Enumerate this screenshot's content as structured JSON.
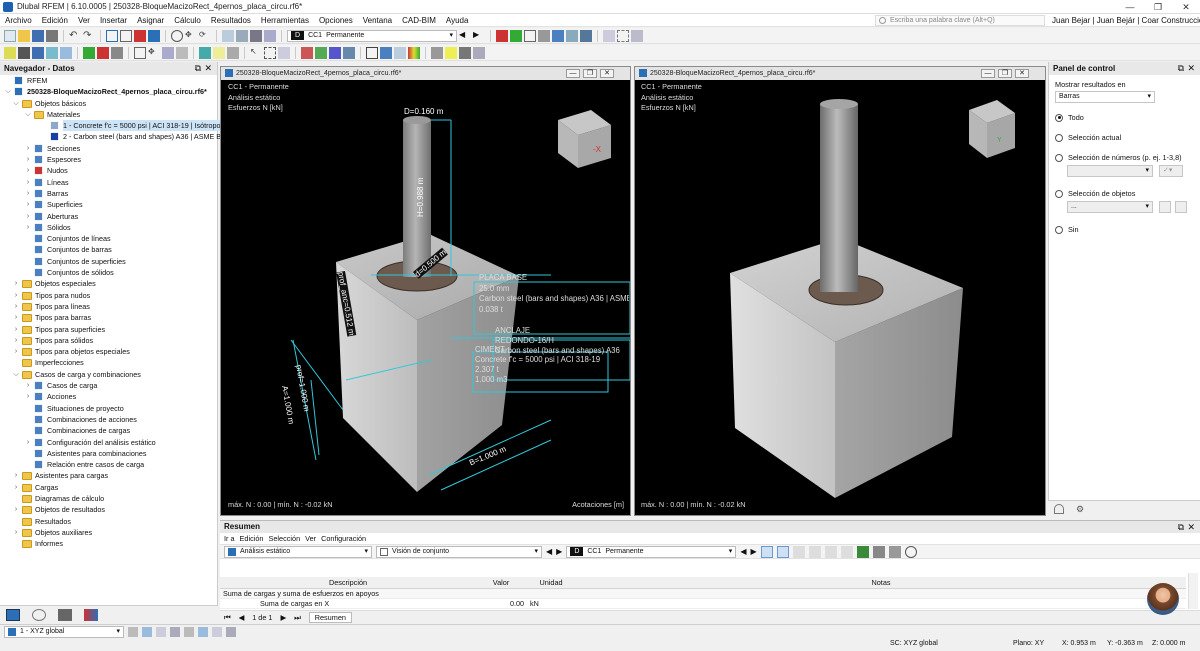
{
  "window": {
    "title": "Dlubal RFEM | 6.10.0005 | 250328-BloqueMacizoRect_4pernos_placa_circu.rf6*"
  },
  "menu": [
    "Archivo",
    "Edición",
    "Ver",
    "Insertar",
    "Asignar",
    "Cálculo",
    "Resultados",
    "Herramientas",
    "Opciones",
    "Ventana",
    "CAD-BIM",
    "Ayuda"
  ],
  "search": {
    "placeholder": "Escriba una palabra clave (Alt+Q)"
  },
  "user": {
    "name": "Juan Bejar | Juan Bejár | Coar Construcciones"
  },
  "toolbar": {
    "design_situation_badge": "D",
    "load_case_code": "CC1",
    "load_case_name": "Permanente"
  },
  "navigator": {
    "title": "Navegador - Datos",
    "items": [
      {
        "label": "RFEM",
        "level": 0,
        "exp": "",
        "icon": "rfem-icon"
      },
      {
        "label": "250328-BloqueMacizoRect_4pernos_placa_circu.rf6*",
        "level": 0,
        "exp": "v",
        "icon": "model-file-icon",
        "bold": true
      },
      {
        "label": "Objetos básicos",
        "level": 1,
        "exp": "v",
        "icon": "folder-icon"
      },
      {
        "label": "Materiales",
        "level": 2,
        "exp": "v",
        "icon": "folder-icon"
      },
      {
        "label": "1 - Concrete f'c = 5000 psi | ACI 318-19 | Isótropo",
        "level": 3,
        "exp": "",
        "icon": "material-concrete-icon",
        "selected": true
      },
      {
        "label": "2 - Carbon steel (bars and shapes) A36 | ASME B",
        "level": 3,
        "exp": "",
        "icon": "material-steel-icon"
      },
      {
        "label": "Secciones",
        "level": 2,
        "exp": ">",
        "icon": "sections-icon"
      },
      {
        "label": "Espesores",
        "level": 2,
        "exp": ">",
        "icon": "thickness-icon"
      },
      {
        "label": "Nudos",
        "level": 2,
        "exp": ">",
        "icon": "node-icon"
      },
      {
        "label": "Líneas",
        "level": 2,
        "exp": ">",
        "icon": "line-icon"
      },
      {
        "label": "Barras",
        "level": 2,
        "exp": ">",
        "icon": "member-icon"
      },
      {
        "label": "Superficies",
        "level": 2,
        "exp": ">",
        "icon": "surface-icon"
      },
      {
        "label": "Aberturas",
        "level": 2,
        "exp": ">",
        "icon": "opening-icon"
      },
      {
        "label": "Sólidos",
        "level": 2,
        "exp": ">",
        "icon": "solid-icon"
      },
      {
        "label": "Conjuntos de líneas",
        "level": 2,
        "exp": "",
        "icon": "line-set-icon"
      },
      {
        "label": "Conjuntos de barras",
        "level": 2,
        "exp": "",
        "icon": "member-set-icon"
      },
      {
        "label": "Conjuntos de superficies",
        "level": 2,
        "exp": "",
        "icon": "surface-set-icon"
      },
      {
        "label": "Conjuntos de sólidos",
        "level": 2,
        "exp": "",
        "icon": "solid-set-icon"
      },
      {
        "label": "Objetos especiales",
        "level": 1,
        "exp": ">",
        "icon": "folder-icon"
      },
      {
        "label": "Tipos para nudos",
        "level": 1,
        "exp": ">",
        "icon": "folder-icon"
      },
      {
        "label": "Tipos para líneas",
        "level": 1,
        "exp": ">",
        "icon": "folder-icon"
      },
      {
        "label": "Tipos para barras",
        "level": 1,
        "exp": ">",
        "icon": "folder-icon"
      },
      {
        "label": "Tipos para superficies",
        "level": 1,
        "exp": ">",
        "icon": "folder-icon"
      },
      {
        "label": "Tipos para sólidos",
        "level": 1,
        "exp": ">",
        "icon": "folder-icon"
      },
      {
        "label": "Tipos para objetos especiales",
        "level": 1,
        "exp": ">",
        "icon": "folder-icon"
      },
      {
        "label": "Imperfecciones",
        "level": 1,
        "exp": "",
        "icon": "folder-icon"
      },
      {
        "label": "Casos de carga y combinaciones",
        "level": 1,
        "exp": "v",
        "icon": "folder-icon"
      },
      {
        "label": "Casos de carga",
        "level": 2,
        "exp": ">",
        "icon": "load-case-icon"
      },
      {
        "label": "Acciones",
        "level": 2,
        "exp": ">",
        "icon": "action-icon"
      },
      {
        "label": "Situaciones de proyecto",
        "level": 2,
        "exp": "",
        "icon": "design-situation-icon"
      },
      {
        "label": "Combinaciones de acciones",
        "level": 2,
        "exp": "",
        "icon": "action-combination-icon"
      },
      {
        "label": "Combinaciones de cargas",
        "level": 2,
        "exp": "",
        "icon": "load-combination-icon"
      },
      {
        "label": "Configuración del análisis estático",
        "level": 2,
        "exp": ">",
        "icon": "static-settings-icon"
      },
      {
        "label": "Asistentes para combinaciones",
        "level": 2,
        "exp": "",
        "icon": "combination-wizard-icon"
      },
      {
        "label": "Relación entre casos de carga",
        "level": 2,
        "exp": "",
        "icon": "relationship-icon"
      },
      {
        "label": "Asistentes para cargas",
        "level": 1,
        "exp": ">",
        "icon": "folder-icon"
      },
      {
        "label": "Cargas",
        "level": 1,
        "exp": ">",
        "icon": "folder-icon"
      },
      {
        "label": "Diagramas de cálculo",
        "level": 1,
        "exp": "",
        "icon": "folder-icon"
      },
      {
        "label": "Objetos de resultados",
        "level": 1,
        "exp": ">",
        "icon": "folder-icon"
      },
      {
        "label": "Resultados",
        "level": 1,
        "exp": "",
        "icon": "folder-icon"
      },
      {
        "label": "Objetos auxiliares",
        "level": 1,
        "exp": ">",
        "icon": "folder-icon"
      },
      {
        "label": "Informes",
        "level": 1,
        "exp": "",
        "icon": "folder-icon"
      }
    ]
  },
  "viewport_left": {
    "tab_title": "250328-BloqueMacizoRect_4pernos_placa_circu.rf6*",
    "info_lines": [
      "CC1 - Permanente",
      "Análisis estático",
      "Esfuerzos N [kN]"
    ],
    "footer_left": "máx. N : 0.00 | mín. N : -0.02 kN",
    "footer_right": "Acotaciones [m]",
    "dims": {
      "diameter": "D=0.160 m",
      "height": "H=0.988 m",
      "depth": "d=0.500 m",
      "prof_anc": "prof_anc=0.512 m",
      "prof": "prof=1.000 m",
      "b_side": "B=1.000 m",
      "a_side": "A=1.000 m"
    },
    "labels": {
      "placa_title": "PLACA BASE",
      "placa_thick": "25.0 mm",
      "placa_mat": "Carbon steel (bars and shapes) A36 | ASME B",
      "placa_weight": "0.038 t",
      "anclaje_title": "ANCLAJE",
      "anclaje_sub": "REDONDO-16/H",
      "anclaje_mat": "Carbon steel (bars and shapes) A36",
      "cim_title": "CIMENT",
      "cim_mat": "Concrete f'c = 5000 psi | ACI 318-19",
      "cim_weight": "2.307 t",
      "cim_vol": "1.000 m3"
    }
  },
  "viewport_right": {
    "tab_title": "250328-BloqueMacizoRect_4pernos_placa_circu.rf6*",
    "info_lines": [
      "CC1 - Permanente",
      "Análisis estático",
      "Esfuerzos N [kN]"
    ],
    "footer_left": "máx. N : 0.00 | mín. N : -0.02 kN"
  },
  "control_panel": {
    "title": "Panel de control",
    "show_results_label": "Mostrar resultados en",
    "show_results_value": "Barras",
    "options": [
      "Todo",
      "Selección actual",
      "Selección de números (p. ej. 1-3,8)",
      "Selección de objetos",
      "Sin"
    ],
    "selected_option": "Todo",
    "sel_objects_placeholder": "..."
  },
  "results": {
    "title": "Resumen",
    "menu": [
      "Ir a",
      "Edición",
      "Selección",
      "Ver",
      "Configuración"
    ],
    "analysis_type": "Análisis estático",
    "view_type": "Visión de conjunto",
    "design_situation_badge": "D",
    "load_case_code": "CC1",
    "load_case_name": "Permanente",
    "columns": [
      "Descripción",
      "Valor",
      "Unidad",
      "Notas"
    ],
    "group_row": "Suma de cargas y suma de esfuerzos en apoyos",
    "rows": [
      {
        "description": "Suma de cargas en X",
        "value": "0.00",
        "unit": "kN",
        "notes": ""
      }
    ],
    "pager": "1 de 1",
    "tab": "Resumen"
  },
  "statusbar": {
    "coord_system_combo": "1 - XYZ global",
    "sc": "SC: XYZ global",
    "plane": "Plano: XY",
    "x": "X: 0.953 m",
    "y": "Y: -0.363 m",
    "z": "Z: 0.000 m"
  },
  "colors": {
    "accent": "#2b6fb7",
    "dimension_cyan": "#32c8d8",
    "viewport_bg": "#000000",
    "folder": "#f0c64a"
  }
}
